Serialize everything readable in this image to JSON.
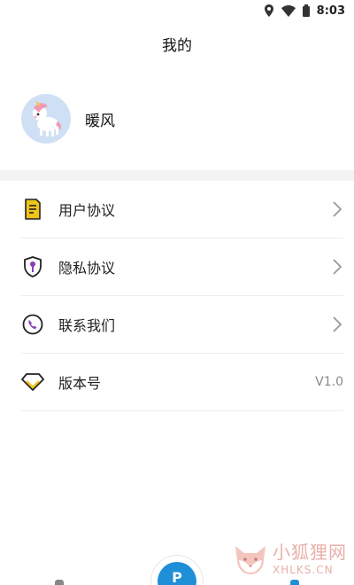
{
  "status_bar": {
    "time": "8:03",
    "icons": [
      "location-icon",
      "wifi-icon",
      "battery-icon"
    ]
  },
  "header": {
    "title": "我的"
  },
  "profile": {
    "avatar_icon": "unicorn-avatar-icon",
    "nickname": "暖风"
  },
  "menu": {
    "items": [
      {
        "label": "用户协议",
        "icon": "document-icon",
        "trailing": "chevron"
      },
      {
        "label": "隐私协议",
        "icon": "shield-icon",
        "trailing": "chevron"
      },
      {
        "label": "联系我们",
        "icon": "phone-icon",
        "trailing": "chevron"
      },
      {
        "label": "版本号",
        "icon": "diamond-icon",
        "trailing": "V1.0"
      }
    ]
  },
  "bottom_nav": {
    "center_button_label": "P"
  },
  "watermark": {
    "text_cn": "小狐狸网",
    "text_en": "XHLKS.CN"
  },
  "colors": {
    "accent": "#1f8fd8",
    "icon_purple": "#8a3fb8",
    "icon_yellow": "#f0c419",
    "divider": "#ececec"
  }
}
